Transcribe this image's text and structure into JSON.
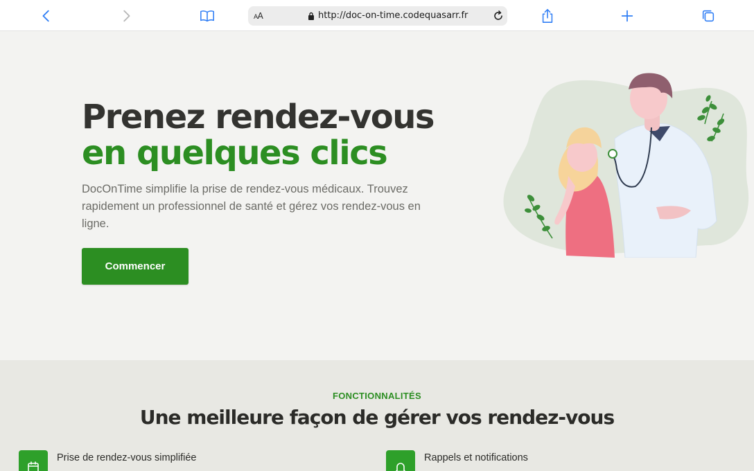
{
  "browser": {
    "url": "http://doc-on-time.codequasarr.fr",
    "reader_label_big": "A",
    "reader_label_small": "A"
  },
  "hero": {
    "title_line1": "Prenez rendez-vous",
    "title_line2": "en quelques clics",
    "description": "DocOnTime simplifie la prise de rendez-vous médicaux. Trouvez rapidement un professionnel de santé et gérez vos rendez-vous en ligne.",
    "cta_label": "Commencer"
  },
  "features": {
    "eyebrow": "FONCTIONNALITÉS",
    "heading": "Une meilleure façon de gérer vos rendez-vous",
    "items": [
      {
        "title": "Prise de rendez-vous simplifiée",
        "icon": "calendar-icon"
      },
      {
        "title": "Rappels et notifications",
        "icon": "bell-icon"
      }
    ]
  },
  "colors": {
    "brand_green": "#2c8e22",
    "icon_green": "#2ea02a",
    "safari_blue": "#2f7ef5"
  }
}
